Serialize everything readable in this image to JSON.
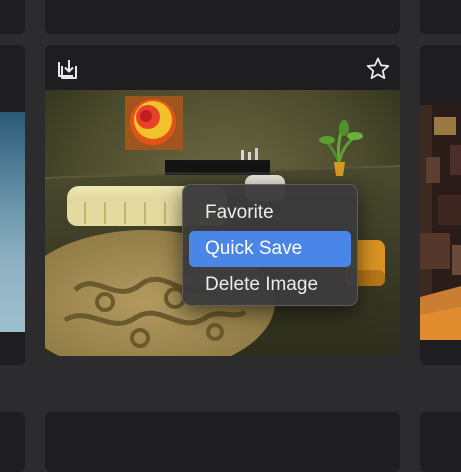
{
  "gallery": {
    "accent_color": "#4a86e8",
    "card": {
      "toolbar": {
        "save_icon": "tray-download-icon",
        "favorite_icon": "star-outline-icon"
      },
      "image": {
        "subject": "living-room-interior"
      }
    }
  },
  "context_menu": {
    "items": [
      {
        "label": "Favorite",
        "selected": false
      },
      {
        "label": "Quick Save",
        "selected": true
      },
      {
        "label": "Delete Image",
        "selected": false
      }
    ]
  }
}
